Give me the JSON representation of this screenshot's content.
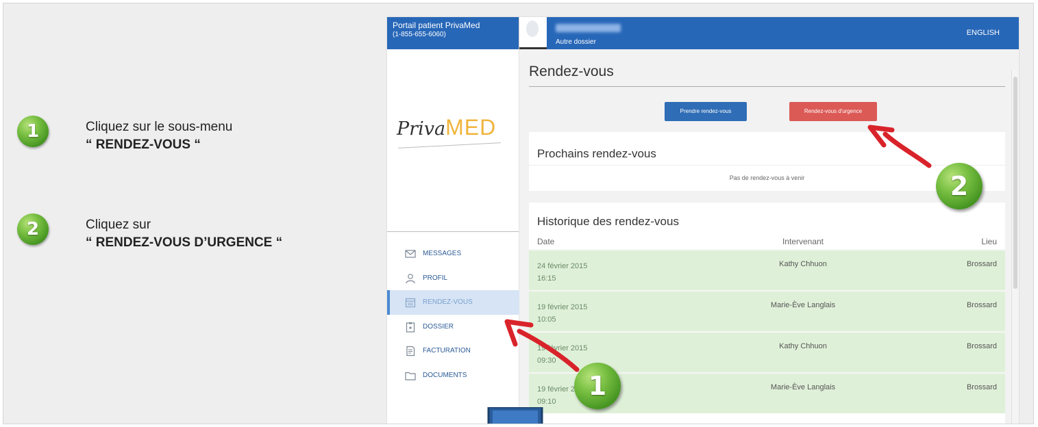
{
  "instructions": [
    {
      "number": "1",
      "line1": "Cliquez sur le sous-menu",
      "line2": "“ RENDEZ-VOUS “"
    },
    {
      "number": "2",
      "line1": "Cliquez sur",
      "line2": "“ RENDEZ-VOUS D’URGENCE “"
    }
  ],
  "portal": {
    "brand_line1": "Portail patient PrivaMed",
    "brand_line2": "(1-855-655-6060)",
    "autre_dossier": "Autre dossier",
    "language_link": "ENGLISH",
    "logo": {
      "part1": "Priva",
      "part2": "MED"
    }
  },
  "sidebar": {
    "items": [
      {
        "label": "MESSAGES",
        "icon": "envelope-icon",
        "active": false
      },
      {
        "label": "PROFIL",
        "icon": "person-icon",
        "active": false
      },
      {
        "label": "RENDEZ-VOUS",
        "icon": "calendar-icon",
        "active": true
      },
      {
        "label": "DOSSIER",
        "icon": "clipboard-icon",
        "active": false
      },
      {
        "label": "FACTURATION",
        "icon": "invoice-icon",
        "active": false
      },
      {
        "label": "DOCUMENTS",
        "icon": "folder-icon",
        "active": false
      }
    ]
  },
  "main": {
    "title": "Rendez-vous",
    "buttons": {
      "prendre": "Prendre rendez-vous",
      "urgence": "Rendez-vous d'urgence"
    },
    "upcoming": {
      "title": "Prochains rendez-vous",
      "empty": "Pas de rendez-vous à venir"
    },
    "history": {
      "title": "Historique des rendez-vous",
      "columns": [
        "Date",
        "Intervenant",
        "Lieu"
      ],
      "rows": [
        {
          "date": "24 février 2015",
          "time": "16:15",
          "person": "Kathy Chhuon",
          "place": "Brossard"
        },
        {
          "date": "19 février 2015",
          "time": "10:05",
          "person": "Marie-Ève Langlais",
          "place": "Brossard"
        },
        {
          "date": "19 février 2015",
          "time": "09:30",
          "person": "Kathy Chhuon",
          "place": "Brossard"
        },
        {
          "date": "19 février 2015",
          "time": "09:10",
          "person": "Marie-Ève Langlais",
          "place": "Brossard"
        }
      ]
    }
  },
  "overlay": {
    "badge1": "1",
    "badge2": "2"
  },
  "colors": {
    "topbar": "#2767b8",
    "primary_button": "#2f6db6",
    "urgent_button": "#dc5a56",
    "row_green": "#dff0d8",
    "arrow_red": "#d9232a",
    "badge_green": "#5aa531",
    "logo_gold": "#f0b43c"
  }
}
